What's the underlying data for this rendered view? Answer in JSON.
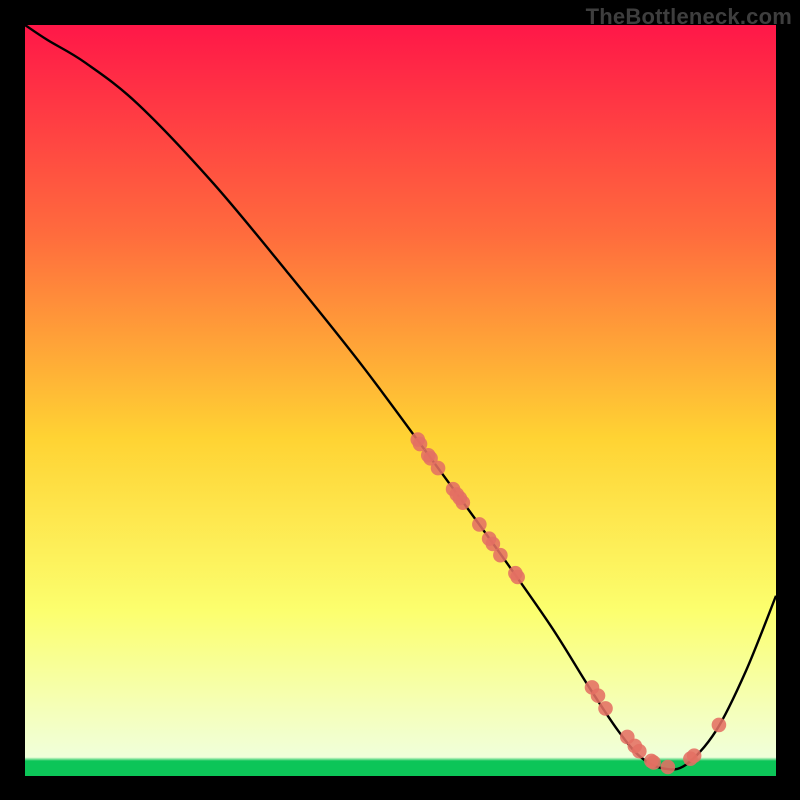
{
  "watermark": "TheBottleneck.com",
  "colors": {
    "background": "#000000",
    "watermark_text": "#3e3e3e",
    "gradient_top": "#ff1748",
    "gradient_upper_mid": "#ff6c3d",
    "gradient_mid": "#ffd333",
    "gradient_lower_mid": "#fcff6e",
    "gradient_band": "#f4ffbe",
    "gradient_bottom": "#0cc558",
    "curve": "#000000",
    "points": "#e46f63"
  },
  "chart_data": {
    "type": "line",
    "title": "",
    "xlabel": "",
    "ylabel": "",
    "xlim": [
      0,
      100
    ],
    "ylim": [
      0,
      100
    ],
    "grid": false,
    "legend": false,
    "series": [
      {
        "name": "bottleneck-curve",
        "x": [
          0,
          3,
          8,
          15,
          25,
          35,
          45,
          55,
          63,
          70,
          75,
          79,
          82,
          85,
          88,
          92,
          96,
          100
        ],
        "y": [
          100,
          98,
          95,
          89.5,
          79,
          67,
          54.5,
          41,
          30,
          20,
          12,
          6,
          2.5,
          1,
          1.5,
          6,
          14,
          24
        ]
      }
    ],
    "points": [
      {
        "x": 52.3,
        "y": 44.8
      },
      {
        "x": 52.6,
        "y": 44.2
      },
      {
        "x": 53.7,
        "y": 42.7
      },
      {
        "x": 54.0,
        "y": 42.3
      },
      {
        "x": 55.0,
        "y": 41.0
      },
      {
        "x": 57.0,
        "y": 38.2
      },
      {
        "x": 57.5,
        "y": 37.5
      },
      {
        "x": 57.9,
        "y": 37.0
      },
      {
        "x": 58.3,
        "y": 36.4
      },
      {
        "x": 60.5,
        "y": 33.5
      },
      {
        "x": 61.8,
        "y": 31.6
      },
      {
        "x": 62.3,
        "y": 30.9
      },
      {
        "x": 63.3,
        "y": 29.4
      },
      {
        "x": 65.3,
        "y": 27.0
      },
      {
        "x": 65.6,
        "y": 26.5
      },
      {
        "x": 75.5,
        "y": 11.8
      },
      {
        "x": 76.3,
        "y": 10.7
      },
      {
        "x": 77.3,
        "y": 9.0
      },
      {
        "x": 80.2,
        "y": 5.2
      },
      {
        "x": 81.2,
        "y": 4.0
      },
      {
        "x": 81.8,
        "y": 3.3
      },
      {
        "x": 83.4,
        "y": 2.0
      },
      {
        "x": 83.7,
        "y": 1.8
      },
      {
        "x": 85.6,
        "y": 1.2
      },
      {
        "x": 88.6,
        "y": 2.3
      },
      {
        "x": 89.1,
        "y": 2.7
      },
      {
        "x": 92.4,
        "y": 6.8
      }
    ]
  }
}
